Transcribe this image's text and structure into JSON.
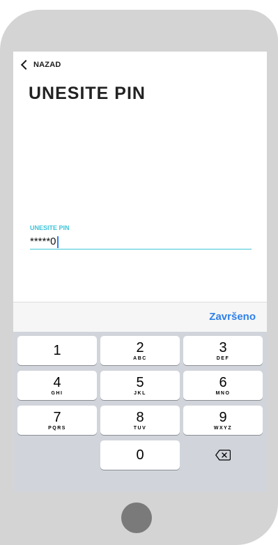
{
  "header": {
    "back_label": "NAZAD",
    "title": "UNESITE PIN"
  },
  "pin": {
    "label": "UNESITE PIN",
    "value": "*****0"
  },
  "accessory": {
    "done_label": "Završeno"
  },
  "keypad": {
    "keys": [
      {
        "num": "1",
        "letters": ""
      },
      {
        "num": "2",
        "letters": "ABC"
      },
      {
        "num": "3",
        "letters": "DEF"
      },
      {
        "num": "4",
        "letters": "GHI"
      },
      {
        "num": "5",
        "letters": "JKL"
      },
      {
        "num": "6",
        "letters": "MNO"
      },
      {
        "num": "7",
        "letters": "PQRS"
      },
      {
        "num": "8",
        "letters": "TUV"
      },
      {
        "num": "9",
        "letters": "WXYZ"
      },
      {
        "num": "0",
        "letters": ""
      }
    ],
    "delete_icon": "backspace-icon"
  },
  "colors": {
    "accent": "#3ec4d8",
    "done": "#2f80e8",
    "keyboard_bg": "#d1d5db",
    "frame": "#d4d4d4"
  }
}
